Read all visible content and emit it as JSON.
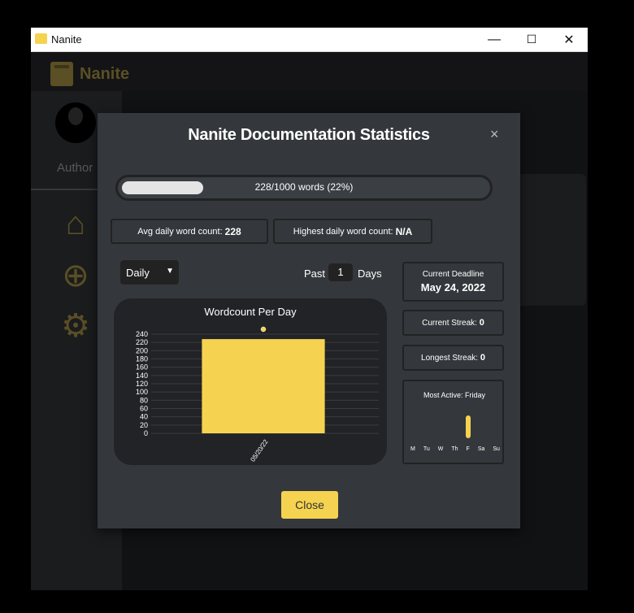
{
  "window": {
    "title": "Nanite",
    "minimize": "—",
    "maximize": "☐",
    "close": "✕"
  },
  "app": {
    "logo_text": "Nanite",
    "author_label": "Author"
  },
  "modal": {
    "title": "Nanite Documentation Statistics",
    "close_x": "×",
    "progress": {
      "text": "228/1000 words (22%)",
      "fraction": 0.22
    },
    "avg_label": "Avg daily word count:",
    "avg_value": "228",
    "highest_label": "Highest daily word count:",
    "highest_value": "N/A",
    "period_select": "Daily",
    "past_label": "Past",
    "past_value": "1",
    "days_label": "Days",
    "deadline_label": "Current Deadline",
    "deadline_value": "May 24, 2022",
    "streak_label": "Current Streak:",
    "streak_value": "0",
    "longest_label": "Longest Streak:",
    "longest_value": "0",
    "most_active_label": "Most Active: Friday",
    "weekdays": [
      "M",
      "Tu",
      "W",
      "Th",
      "F",
      "Sa",
      "Su"
    ],
    "weekday_activity": [
      0,
      0,
      0,
      0,
      1,
      0,
      0
    ],
    "close_button": "Close"
  },
  "chart_data": {
    "type": "bar",
    "title": "Wordcount Per Day",
    "categories": [
      "05/20/22"
    ],
    "values": [
      228
    ],
    "ylim": [
      0,
      240
    ],
    "yticks": [
      0,
      20,
      40,
      60,
      80,
      100,
      120,
      140,
      160,
      180,
      200,
      220,
      240
    ],
    "grid": true,
    "legend": "top",
    "bar_color": "#f5d350"
  },
  "colors": {
    "accent": "#f5d350",
    "brand_muted": "#8a7a3a",
    "modal_bg": "#34383c",
    "chart_bg": "#222326"
  }
}
